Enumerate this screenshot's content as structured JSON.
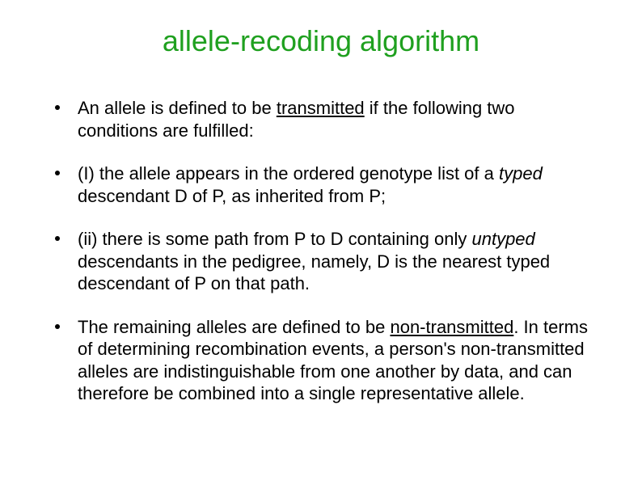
{
  "title": "allele-recoding algorithm",
  "bullets": [
    {
      "pre": "An allele is defined to be ",
      "u": "transmitted",
      "post": " if the following two conditions are fulfilled:"
    },
    {
      "pre": "(I) the allele appears in the ordered genotype list of a ",
      "i": "typed",
      "post": " descendant D of P, as inherited from P;"
    },
    {
      "pre": "(ii) there is some path from P to D containing only ",
      "i": "untyped",
      "post": " descendants in the pedigree, namely, D is the nearest typed descendant of P on that path."
    },
    {
      "pre": "The remaining alleles are defined to be ",
      "u": "non-transmitted",
      "post": ". In terms of determining recombination events, a person's non-transmitted alleles are indistinguishable from one another by data, and can therefore be combined into a single representative allele."
    }
  ]
}
